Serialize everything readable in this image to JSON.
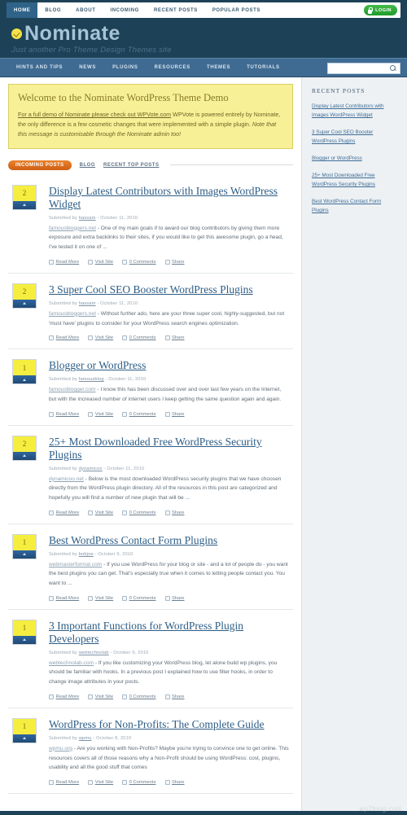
{
  "topnav": {
    "items": [
      {
        "label": "HOME",
        "active": true
      },
      {
        "label": "BLOG",
        "active": false
      },
      {
        "label": "ABOUT",
        "active": false
      },
      {
        "label": "INCOMING",
        "active": false
      },
      {
        "label": "RECENT POSTS",
        "active": false
      },
      {
        "label": "POPULAR POSTS",
        "active": false
      }
    ],
    "login_label": "LOGIN"
  },
  "brand": {
    "title": "Nominate",
    "tagline": "Just another Pro Theme Design Themes site"
  },
  "subnav": {
    "items": [
      {
        "label": "HINTS AND TIPS"
      },
      {
        "label": "NEWS"
      },
      {
        "label": "PLUGINS"
      },
      {
        "label": "RESOURCES"
      },
      {
        "label": "THEMES"
      },
      {
        "label": "TUTORIALS"
      }
    ],
    "search_value": "",
    "search_placeholder": ""
  },
  "welcome": {
    "title": "Welcome to the Nominate WordPress Theme Demo",
    "link_text": "For a full demo of Nominate please check out WPVote.com",
    "body_text": " WPVote is powered entirely by Nominate, the only difference is a few cosmetic changes that were implemented with a simple plugin. ",
    "body_italic": "Note that this message is customisable through the Nominate admin too!"
  },
  "tabs": [
    {
      "label": "INCOMING POSTS",
      "active": true
    },
    {
      "label": "BLOG",
      "active": false
    },
    {
      "label": "RECENT TOP POSTS",
      "active": false
    }
  ],
  "actions": {
    "read_more": "Read More",
    "visit_site": "Visit Site",
    "comments": "0 Comments",
    "share": "Share"
  },
  "posts": [
    {
      "votes": "2",
      "title": "Display Latest Contributors with Images WordPress Widget",
      "meta_prefix": "Submitted by ",
      "author": "hassam",
      "meta_suffix": " - October 11, 2010",
      "source": "famousbloggers.net",
      "excerpt": " - One of my main goals if to award our blog contributors by giving them more exposure and extra backlinks to their sites, if you would like to get this awesome plugin, go a head, I've tested it on one of ..."
    },
    {
      "votes": "2",
      "title": "3 Super Cool SEO Booster WordPress Plugins",
      "meta_prefix": "Submitted by ",
      "author": "hassam",
      "meta_suffix": " - October 11, 2010",
      "source": "famousbloggers.net",
      "excerpt": " - Without further ado, here are your three super cool, highly-suggested, but not 'must have' plugins to consider for your WordPress search engines optimization."
    },
    {
      "votes": "1",
      "title": "Blogger or WordPress",
      "meta_prefix": "Submitted by ",
      "author": "famousblog",
      "meta_suffix": " - October 11, 2010",
      "source": "famousblogger.com",
      "excerpt": " - I know this has been discussed over and over last few years on the Internet, but with the increased number of internet users I keep getting the same question again and again."
    },
    {
      "votes": "2",
      "title": "25+ Most Downloaded Free WordPress Security Plugins",
      "meta_prefix": "Submitted by ",
      "author": "dynamicoo",
      "meta_suffix": " - October 11, 2010",
      "source": "dynamicoo.net",
      "excerpt": " - Below is the most downloaded WordPress security plugins that we have choosen directly from the WordPress plugin directory. All of the resources in this post are categorized and hopefully you will find a number of new plugin that will be ..."
    },
    {
      "votes": "1",
      "title": "Best WordPress Contact Form Plugins",
      "meta_prefix": "Submitted by ",
      "author": "bobjoe",
      "meta_suffix": " - October 9, 2010",
      "source": "webmasterformat.com",
      "excerpt": " - If you use WordPress for your blog or site - and a lot of people do - you want the best plugins you can get. That's especially true when it comes to letting people contact you. You want to ..."
    },
    {
      "votes": "1",
      "title": "3 Important Functions for WordPress Plugin Developers",
      "meta_prefix": "Submitted by ",
      "author": "webtechnolab",
      "meta_suffix": " - October 9, 2010",
      "source": "webtechnolab.com",
      "excerpt": " - If you like customizing your WordPress blog, let alone build wp plugins, you should be familiar with hooks. In a previous post I explained how to use filter hooks, in order to change image attributes in your posts."
    },
    {
      "votes": "1",
      "title": "WordPress for Non-Profits: The Complete Guide",
      "meta_prefix": "Submitted by ",
      "author": "wpmu",
      "meta_suffix": " - October 8, 2010",
      "source": "wpmu.org",
      "excerpt": " - Are you working with Non-Profits? Maybe you're trying to convince one to get online. This resources covers all of those reasons why a Non-Profit should be using WordPress: cost, plugins, usability and all the good stuff that comes"
    }
  ],
  "sidebar": {
    "title": "RECENT POSTS",
    "links": [
      "Display Latest Contributors with Images WordPress Widget",
      "3 Super Cool SEO Booster WordPress Plugins",
      "Blogger or WordPress",
      "25+ Most Downloaded Free WordPress Security Plugins",
      "Best WordPress Contact Form Plugins"
    ]
  },
  "watermark": "wp2blog.com"
}
